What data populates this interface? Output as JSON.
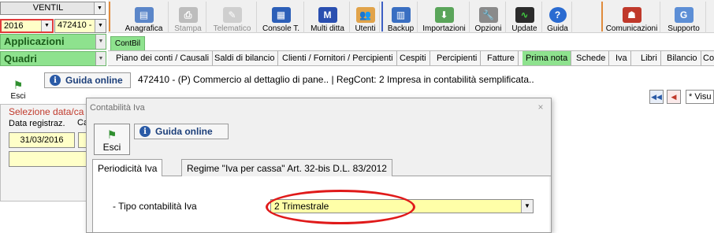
{
  "selectors": {
    "company_name": "VENTIL",
    "year": "2016",
    "company_code": "472410 -",
    "applicazioni": "Applicazioni",
    "quadri": "Quadri"
  },
  "toolbar": [
    {
      "label": "Anagrafica",
      "icon": "book-icon",
      "enabled": true
    },
    {
      "label": "Stampa",
      "icon": "printer-icon",
      "enabled": false
    },
    {
      "label": "Telematico",
      "icon": "wand-icon",
      "enabled": false
    },
    {
      "label": "Console T.",
      "icon": "console-icon",
      "enabled": true
    },
    {
      "label": "Multi ditta",
      "icon": "m-icon",
      "enabled": true
    },
    {
      "label": "Utenti",
      "icon": "users-icon",
      "enabled": true
    },
    {
      "label": "Backup",
      "icon": "backup-icon",
      "enabled": true
    },
    {
      "label": "Importazioni",
      "icon": "download-icon",
      "enabled": true
    },
    {
      "label": "Opzioni",
      "icon": "wrench-icon",
      "enabled": true
    },
    {
      "label": "Update",
      "icon": "monitor-icon",
      "enabled": true
    },
    {
      "label": "Guida",
      "icon": "help-icon",
      "enabled": true
    },
    {
      "label": "Comunicazioni",
      "icon": "person-icon",
      "enabled": true
    },
    {
      "label": "Supporto",
      "icon": "support-icon",
      "enabled": true
    }
  ],
  "app_tab": "ContBil",
  "menu": [
    "Piano dei conti / Causali",
    "Saldi di bilancio",
    "Clienti / Fornitori / Percipienti",
    "Cespiti",
    "Percipienti",
    "Fatture",
    "Prima nota",
    "Schede",
    "Iva",
    "Libri",
    "Bilancio",
    "Co"
  ],
  "active_menu": "Prima nota",
  "subbar": {
    "esci": "Esci",
    "guida": "Guida online",
    "info_text": "472410 - (P) Commercio al dettaglio di pane.. | RegCont: 2 Impresa  in contabilità semplificata..",
    "visu_label": "* Visu"
  },
  "background_panel": {
    "section_label": "Selezione data/ca",
    "data_label": "Data registraz.",
    "ca_label": "Ca",
    "date_value": "31/03/2016"
  },
  "dialog": {
    "title": "Contabilità Iva",
    "esci": "Esci",
    "guida": "Guida online",
    "tabs": [
      "Periodicità Iva",
      "Regime \"Iva per cassa\" Art. 32-bis D.L. 83/2012"
    ],
    "field_label": "- Tipo contabilità Iva",
    "field_value": "2 Trimestrale"
  },
  "colors": {
    "accent_green": "#8ee28e",
    "field_yellow": "#ffffc8",
    "highlight_red": "#e01a1a"
  }
}
